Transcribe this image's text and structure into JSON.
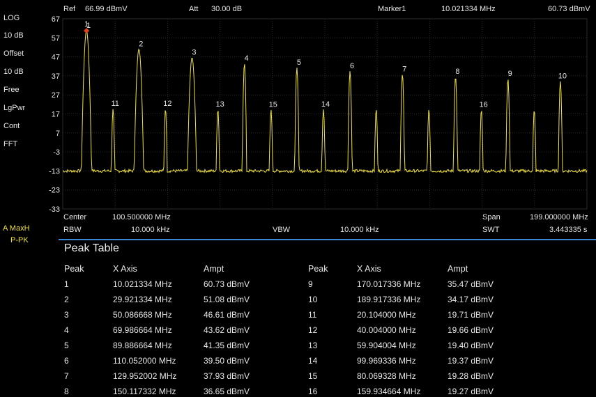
{
  "header": {
    "ref_label": "Ref",
    "ref_value": "66.99 dBmV",
    "att_label": "Att",
    "att_value": "30.00 dB",
    "marker_label": "Marker1",
    "marker_freq": "10.021334 MHz",
    "marker_ampt": "60.73 dBmV"
  },
  "sidebar": {
    "scale": "LOG",
    "div": "10 dB",
    "offset_label": "Offset",
    "offset_value": "10 dB",
    "run": "Free",
    "det": "LgPwr",
    "sweep": "Cont",
    "mode": "FFT",
    "trace": "A MaxH",
    "trace_det": "P-PK"
  },
  "footer": {
    "center_label": "Center",
    "center_value": "100.500000 MHz",
    "span_label": "Span",
    "span_value": "199.000000 MHz",
    "rbw_label": "RBW",
    "rbw_value": "10.000 kHz",
    "vbw_label": "VBW",
    "vbw_value": "10.000 kHz",
    "swt_label": "SWT",
    "swt_value": "3.443335 s"
  },
  "colors": {
    "trace": "#f2e33a",
    "marker": "#e0431f",
    "divider": "#3a86d6"
  },
  "chart_data": {
    "type": "line",
    "x_unit": "MHz",
    "xlim": [
      1.0,
      200.0
    ],
    "ylim": [
      -33,
      67
    ],
    "y_ticks": [
      67,
      57,
      47,
      37,
      27,
      17,
      7,
      -3,
      -13,
      -23,
      -33
    ],
    "noise_floor": -13,
    "peaks": [
      {
        "label": "1",
        "x": 10.021334,
        "y": 60.73
      },
      {
        "label": "2",
        "x": 29.921334,
        "y": 51.08
      },
      {
        "label": "3",
        "x": 50.086668,
        "y": 46.61
      },
      {
        "label": "4",
        "x": 69.986664,
        "y": 43.62
      },
      {
        "label": "5",
        "x": 89.886664,
        "y": 41.35
      },
      {
        "label": "6",
        "x": 110.052,
        "y": 39.5
      },
      {
        "label": "7",
        "x": 129.952002,
        "y": 37.93
      },
      {
        "label": "8",
        "x": 150.117332,
        "y": 36.65
      },
      {
        "label": "9",
        "x": 170.017336,
        "y": 35.47
      },
      {
        "label": "10",
        "x": 189.917336,
        "y": 34.17
      },
      {
        "label": "11",
        "x": 20.104,
        "y": 19.71
      },
      {
        "label": "12",
        "x": 40.004,
        "y": 19.66
      },
      {
        "label": "13",
        "x": 59.904004,
        "y": 19.4
      },
      {
        "label": "14",
        "x": 99.969336,
        "y": 19.37
      },
      {
        "label": "15",
        "x": 80.069328,
        "y": 19.28
      },
      {
        "label": "16",
        "x": 159.934664,
        "y": 19.27
      }
    ],
    "unlabeled_peaks": [
      {
        "x": 120.0,
        "y": 19.5
      },
      {
        "x": 140.0,
        "y": 19.4
      },
      {
        "x": 180.0,
        "y": 19.2
      }
    ]
  },
  "peak_table": {
    "title": "Peak Table",
    "headers": [
      "Peak",
      "X Axis",
      "Ampt"
    ],
    "left": [
      [
        "1",
        "10.021334 MHz",
        "60.73 dBmV"
      ],
      [
        "2",
        "29.921334 MHz",
        "51.08 dBmV"
      ],
      [
        "3",
        "50.086668 MHz",
        "46.61 dBmV"
      ],
      [
        "4",
        "69.986664 MHz",
        "43.62 dBmV"
      ],
      [
        "5",
        "89.886664 MHz",
        "41.35 dBmV"
      ],
      [
        "6",
        "110.052000 MHz",
        "39.50 dBmV"
      ],
      [
        "7",
        "129.952002 MHz",
        "37.93 dBmV"
      ],
      [
        "8",
        "150.117332 MHz",
        "36.65 dBmV"
      ]
    ],
    "right": [
      [
        "9",
        "170.017336 MHz",
        "35.47 dBmV"
      ],
      [
        "10",
        "189.917336 MHz",
        "34.17 dBmV"
      ],
      [
        "11",
        "20.104000 MHz",
        "19.71 dBmV"
      ],
      [
        "12",
        "40.004000 MHz",
        "19.66 dBmV"
      ],
      [
        "13",
        "59.904004 MHz",
        "19.40 dBmV"
      ],
      [
        "14",
        "99.969336 MHz",
        "19.37 dBmV"
      ],
      [
        "15",
        "80.069328 MHz",
        "19.28 dBmV"
      ],
      [
        "16",
        "159.934664 MHz",
        "19.27 dBmV"
      ]
    ]
  }
}
